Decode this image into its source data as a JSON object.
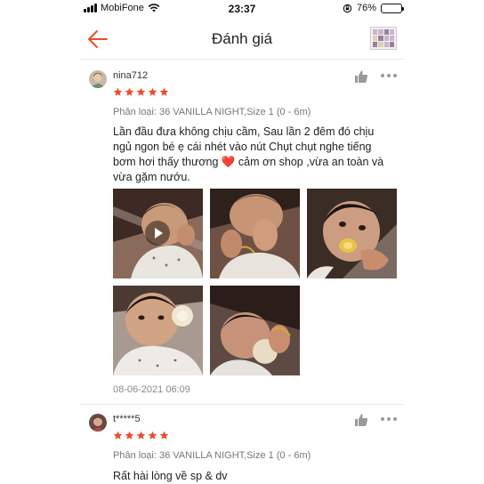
{
  "status_bar": {
    "carrier": "MobiFone",
    "time": "23:37",
    "battery": "76%",
    "battery_level": 0.76
  },
  "header": {
    "title": "Đánh giá",
    "back_icon": "arrow-left-icon",
    "accent_color": "#ee4d2d"
  },
  "reviews": [
    {
      "username": "nina712",
      "rating": 5,
      "variant": "Phân loại: 36 VANILLA NIGHT,Size 1 (0 - 6m)",
      "comment_lines": [
        "Lần đầu đưa không chịu cầm, Sau lần 2 đêm đó chịu",
        "ngủ ngon bé ẹ cái nhét vào nút Chụt chụt nghe tiếng",
        "bơm hơi thấy thương ❤️ cảm ơn shop ,vừa an toàn  và",
        "vừa gặm nướu."
      ],
      "photo_count": 5,
      "date": "08-06-2021 06:09"
    },
    {
      "username": "t*****5",
      "rating": 5,
      "variant": "Phân loại: 36 VANILLA NIGHT,Size 1 (0 - 6m)",
      "comment_lines": [
        "Rất hài lòng về sp & dv"
      ]
    }
  ],
  "star_color": "#ee4d2d"
}
